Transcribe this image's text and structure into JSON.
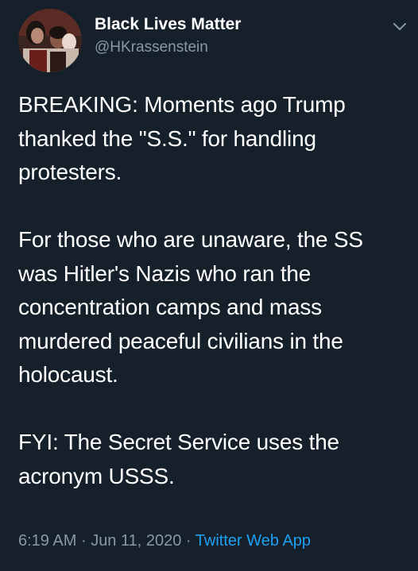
{
  "author": {
    "display_name": "Black Lives Matter",
    "handle": "@HKrassenstein"
  },
  "tweet": {
    "text": "BREAKING: Moments ago Trump thanked the \"S.S.\" for handling protesters.\n\nFor those who are unaware, the SS was Hitler's Nazis who ran the concentration camps and mass murdered peaceful civilians in the holocaust.\n\nFYI: The Secret Service uses the acronym USSS.",
    "time": "6:19 AM",
    "date": "Jun 11, 2020",
    "separator": "·",
    "source": "Twitter Web App"
  },
  "icons": {
    "menu": "chevron-down-icon",
    "avatar": "avatar-photo"
  },
  "colors": {
    "background": "#15202b",
    "text": "#ffffff",
    "secondary": "#8899a6",
    "link": "#1da1f2"
  }
}
